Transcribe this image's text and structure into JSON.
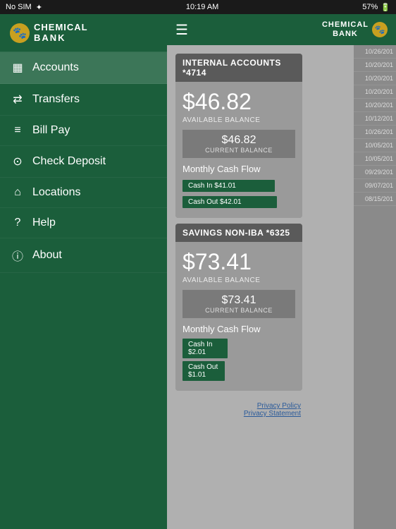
{
  "statusBar": {
    "carrier": "No SIM",
    "wifi": "▾",
    "time": "10:19 AM",
    "battery": "57%"
  },
  "sidebar": {
    "logo": {
      "line1": "CHEMICAL",
      "line2": "BANK"
    },
    "items": [
      {
        "id": "accounts",
        "label": "Accounts",
        "icon": "▦",
        "active": true
      },
      {
        "id": "transfers",
        "label": "Transfers",
        "icon": "⇄"
      },
      {
        "id": "billpay",
        "label": "Bill Pay",
        "icon": "📄"
      },
      {
        "id": "checkdeposit",
        "label": "Check Deposit",
        "icon": "📷"
      },
      {
        "id": "locations",
        "label": "Locations",
        "icon": "🏛"
      },
      {
        "id": "help",
        "label": "Help",
        "icon": "❓"
      },
      {
        "id": "about",
        "label": "About",
        "icon": "ℹ"
      }
    ]
  },
  "topBar": {
    "logoLine1": "CHEMICAL",
    "logoLine2": "BANK"
  },
  "accounts": [
    {
      "id": "internal",
      "headerLabel": "INTERNAL ACCOUNTS *4714",
      "availableBalance": "$46.82",
      "availableBalanceLabel": "AVAILABLE BALANCE",
      "currentBalance": "$46.82",
      "currentBalanceLabel": "CURRENT BALANCE",
      "cashFlowTitle": "Monthly Cash Flow",
      "cashIn": "Cash In $41.01",
      "cashInWidth": "82%",
      "cashOut": "Cash Out $42.01",
      "cashOutWidth": "84%",
      "transactions": [
        {
          "date": "10/26/201"
        },
        {
          "date": "10/20/201"
        },
        {
          "date": "10/20/201"
        },
        {
          "date": "10/20/201"
        },
        {
          "date": "10/20/201"
        },
        {
          "date": "10/12/201"
        }
      ]
    },
    {
      "id": "savings",
      "headerLabel": "SAVINGS NON-IBA *6325",
      "availableBalance": "$73.41",
      "availableBalanceLabel": "AVAILABLE BALANCE",
      "currentBalance": "$73.41",
      "currentBalanceLabel": "CURRENT BALANCE",
      "cashFlowTitle": "Monthly Cash Flow",
      "cashIn": "Cash In $2.01",
      "cashInWidth": "40%",
      "cashOut": "Cash Out $1.01",
      "cashOutWidth": "25%",
      "transactions": [
        {
          "date": "10/26/201"
        },
        {
          "date": "10/05/201"
        },
        {
          "date": "10/05/201"
        },
        {
          "date": "09/29/201"
        },
        {
          "date": "09/07/201"
        },
        {
          "date": "08/15/201"
        }
      ]
    }
  ],
  "footer": {
    "privacyPolicy": "Privacy Policy",
    "privacyStatement": "Privacy Statement"
  }
}
